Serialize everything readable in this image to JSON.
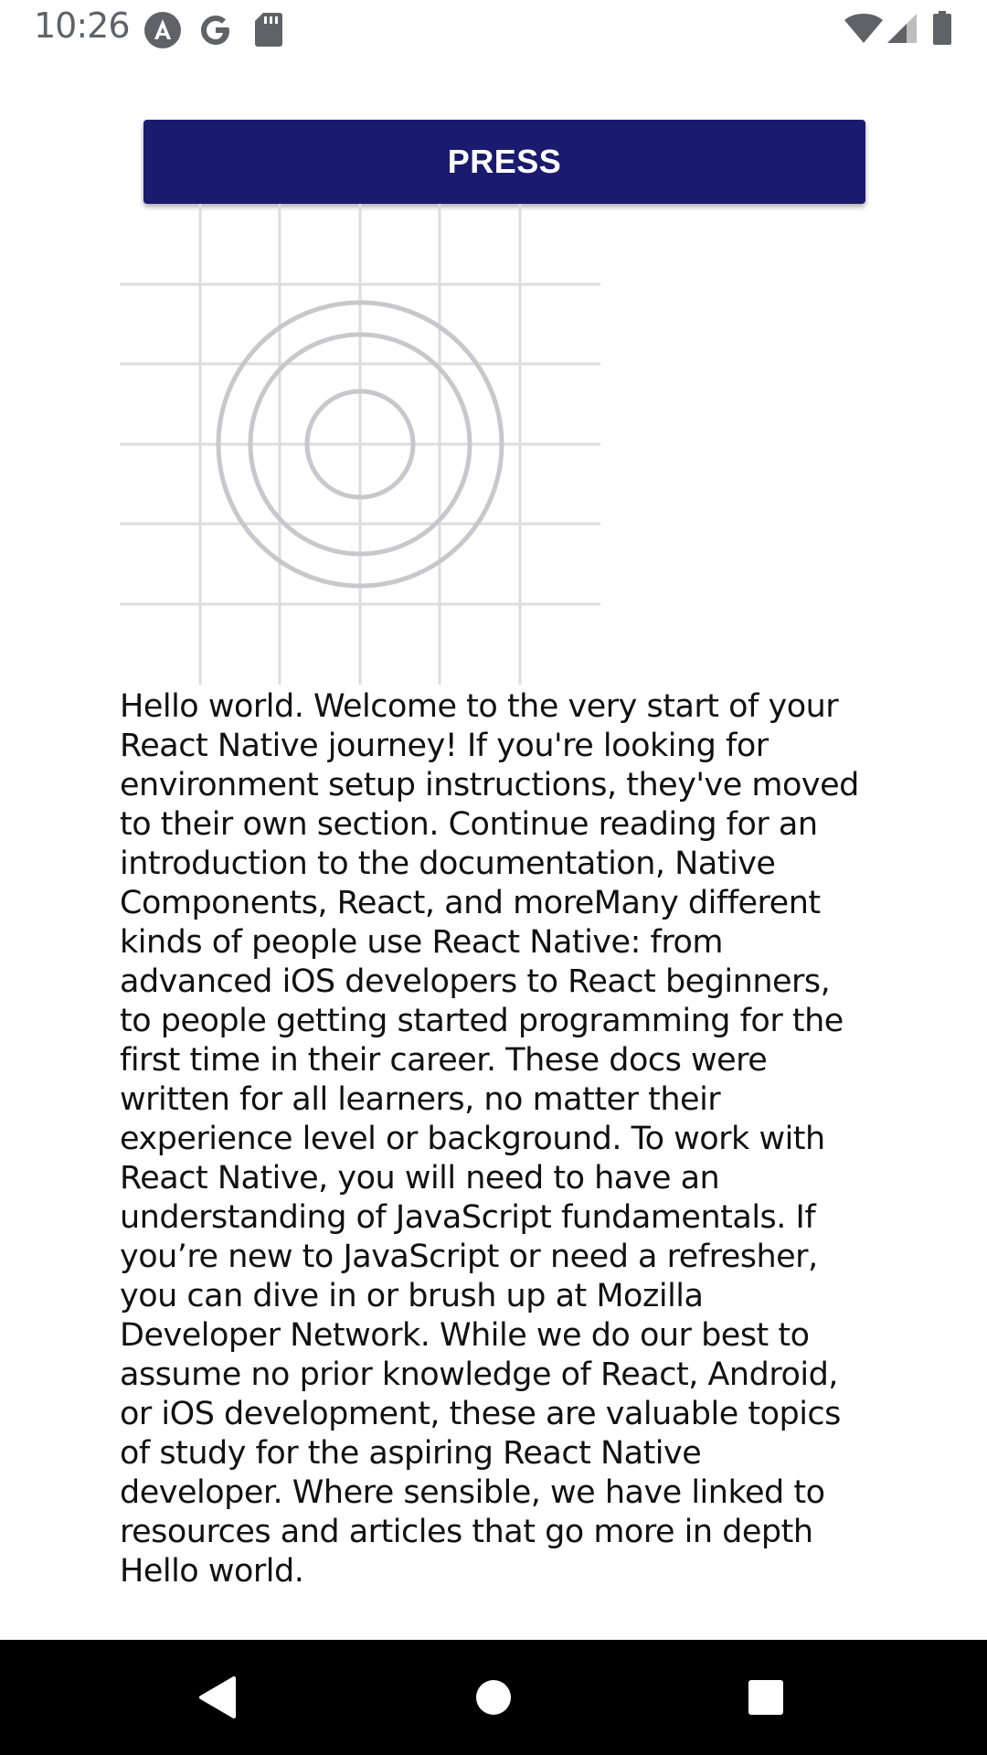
{
  "status_bar": {
    "time": "10:26",
    "notification_icons": [
      "android-studio-icon",
      "google-icon",
      "sd-card-icon"
    ],
    "system_icons": [
      "wifi-icon",
      "cell-signal-icon",
      "battery-icon"
    ]
  },
  "main": {
    "button_label": "PRESS",
    "image_icon": "react-grid-logo",
    "paragraph": "Hello world. Welcome to the very start of your React Native journey! If you're looking for environment setup instructions, they've moved to their own section. Continue reading for an introduction to the documentation, Native Components, React, and moreMany different kinds of people use React Native: from advanced iOS developers to React beginners, to people getting started programming for the first time in their career. These docs were written for all learners, no matter their experience level or background. To work with React Native, you will need to have an understanding of JavaScript fundamentals. If you’re new to JavaScript or need a refresher, you can dive in or brush up at Mozilla Developer Network. While we do our best to assume no prior knowledge of React, Android, or iOS development, these are valuable topics of study for the aspiring React Native developer. Where sensible, we have linked to resources and articles that go more in depth Hello world."
  },
  "nav_bar": {
    "buttons": [
      "back-icon",
      "home-icon",
      "recents-icon"
    ]
  },
  "colors": {
    "button_bg": "#1a1a6e",
    "button_text": "#ffffff",
    "grid_lines": "#dcdcdc",
    "circles": "#c8c8cc",
    "nav_bg": "#000000",
    "status_text": "#5f6368"
  }
}
